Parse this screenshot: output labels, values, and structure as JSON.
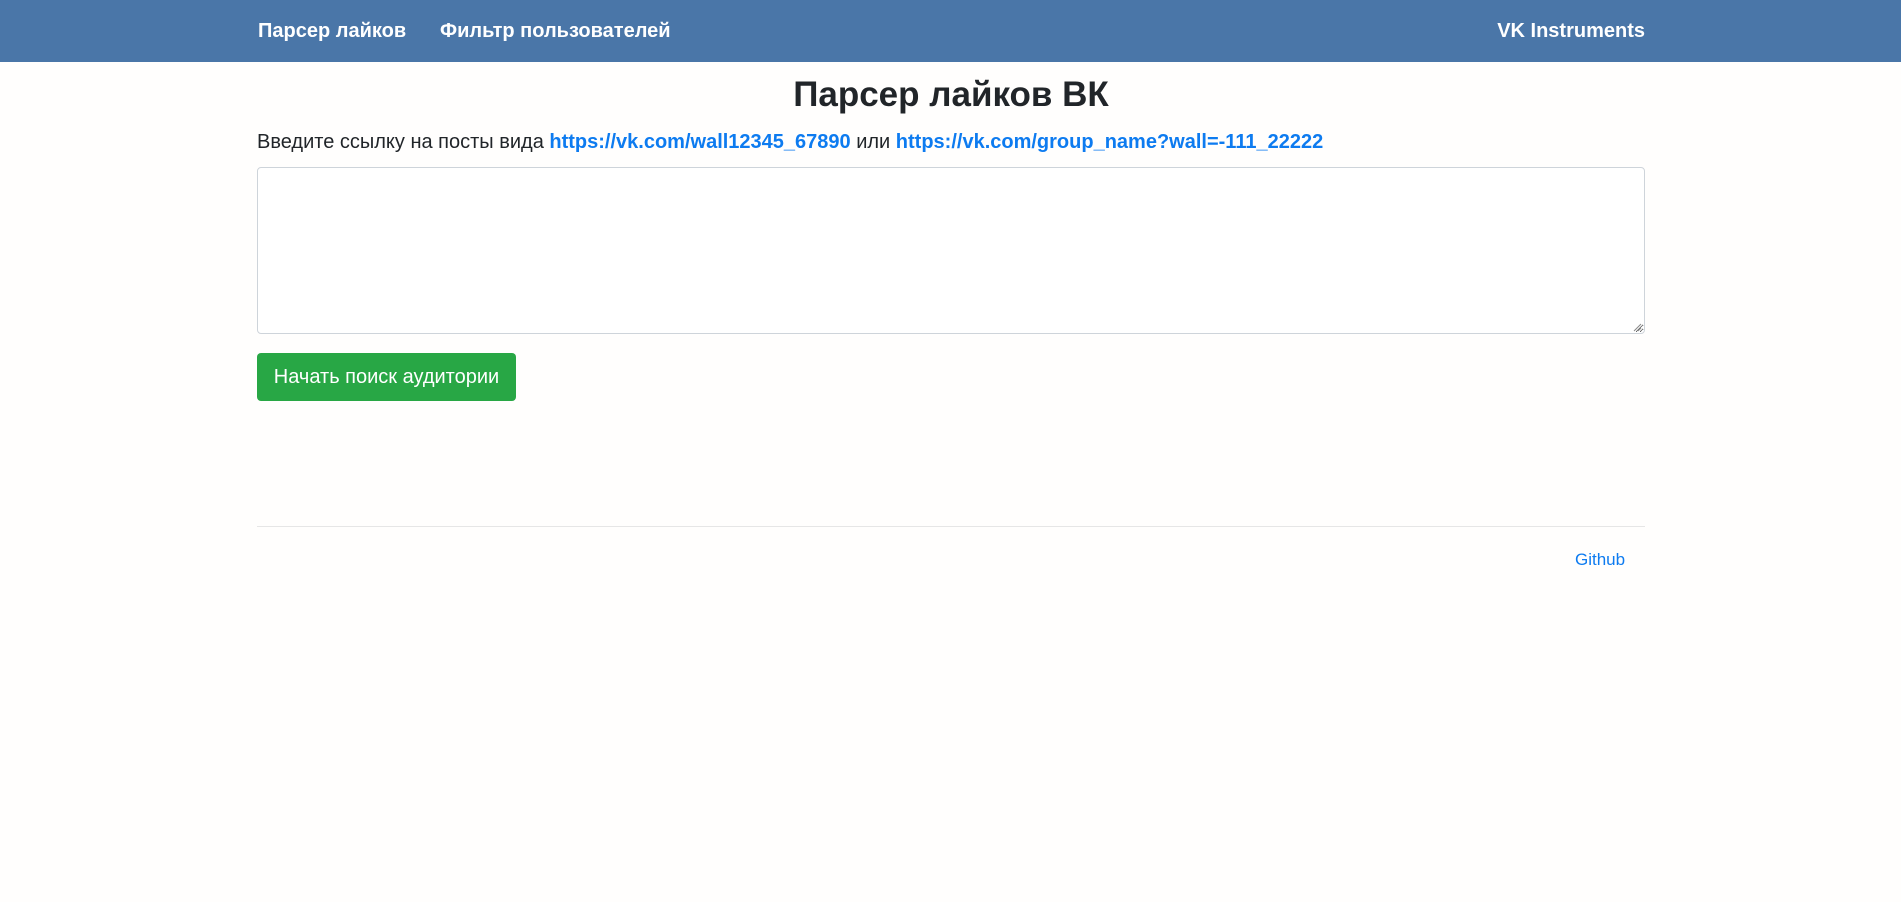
{
  "navbar": {
    "links": [
      {
        "label": "Парсер лайков"
      },
      {
        "label": "Фильтр пользователей"
      }
    ],
    "brand": "VK Instruments"
  },
  "main": {
    "title": "Парсер лайков ВК",
    "intro_prefix": "Введите ссылку на посты вида ",
    "example_link_1": "https://vk.com/wall12345_67890",
    "intro_middle": " или ",
    "example_link_2": "https://vk.com/group_name?wall=-111_22222",
    "textarea_value": "",
    "submit_label": "Начать поиск аудитории"
  },
  "footer": {
    "github_label": "Github"
  },
  "colors": {
    "navbar_bg": "#4a76a8",
    "button_bg": "#28a745",
    "link": "#0d7bf0"
  },
  "icons": {
    "textarea_resize": "resize-grip-icon"
  }
}
